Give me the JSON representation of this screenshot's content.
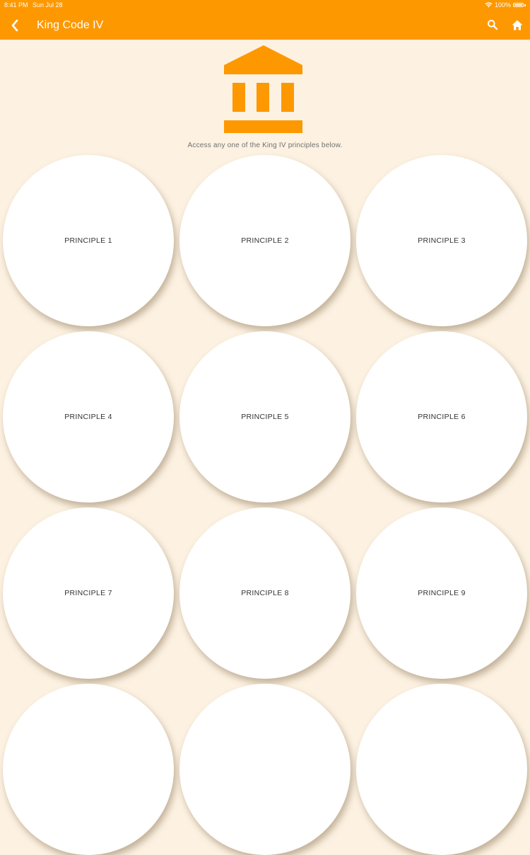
{
  "status_bar": {
    "time": "8:41 PM",
    "date": "Sun Jul 28",
    "battery": "100%"
  },
  "header": {
    "title": "King Code IV",
    "back_icon": "chevron-left-icon",
    "search_icon": "search-icon",
    "home_icon": "home-icon"
  },
  "hero": {
    "icon": "bank-building-icon"
  },
  "intro_text": "Access any one of the King IV principles below.",
  "principles": [
    {
      "label": "PRINCIPLE 1"
    },
    {
      "label": "PRINCIPLE 2"
    },
    {
      "label": "PRINCIPLE 3"
    },
    {
      "label": "PRINCIPLE 4"
    },
    {
      "label": "PRINCIPLE 5"
    },
    {
      "label": "PRINCIPLE 6"
    },
    {
      "label": "PRINCIPLE 7"
    },
    {
      "label": "PRINCIPLE 8"
    },
    {
      "label": "PRINCIPLE 9"
    },
    {
      "label": ""
    },
    {
      "label": ""
    },
    {
      "label": ""
    }
  ],
  "colors": {
    "accent": "#fe9800",
    "background": "#fdf2e2",
    "card": "#ffffff"
  }
}
